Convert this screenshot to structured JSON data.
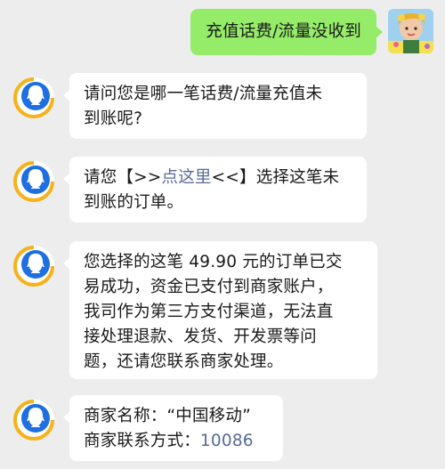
{
  "user_message": {
    "text": "充值话费/流量没收到"
  },
  "bot_messages": [
    {
      "line1": "请问您是哪一笔话费/流量充值未",
      "line2": "到账呢?"
    },
    {
      "line1_prefix": "请您【>>",
      "line1_link": "点这里",
      "line1_suffix": "<<】选择这笔未",
      "line2": "到账的订单。"
    },
    {
      "line1": "您选择的这笔 49.90 元的订单已交",
      "line2": "易成功，资金已支付到商家账户，",
      "line3": "我司作为第三方支付渠道，无法直",
      "line4": "接处理退款、发货、开发票等问",
      "line5": "题，还请您联系商家处理。"
    },
    {
      "line1": "商家名称：“中国移动”",
      "line2_prefix": "商家联系方式：",
      "line2_phone": "10086"
    }
  ],
  "colors": {
    "background": "#ededed",
    "user_bubble": "#95ec69",
    "bot_bubble": "#ffffff",
    "link": "#576b95",
    "bot_logo": "#1e6fe0",
    "bot_logo_accent": "#f5b21a"
  }
}
